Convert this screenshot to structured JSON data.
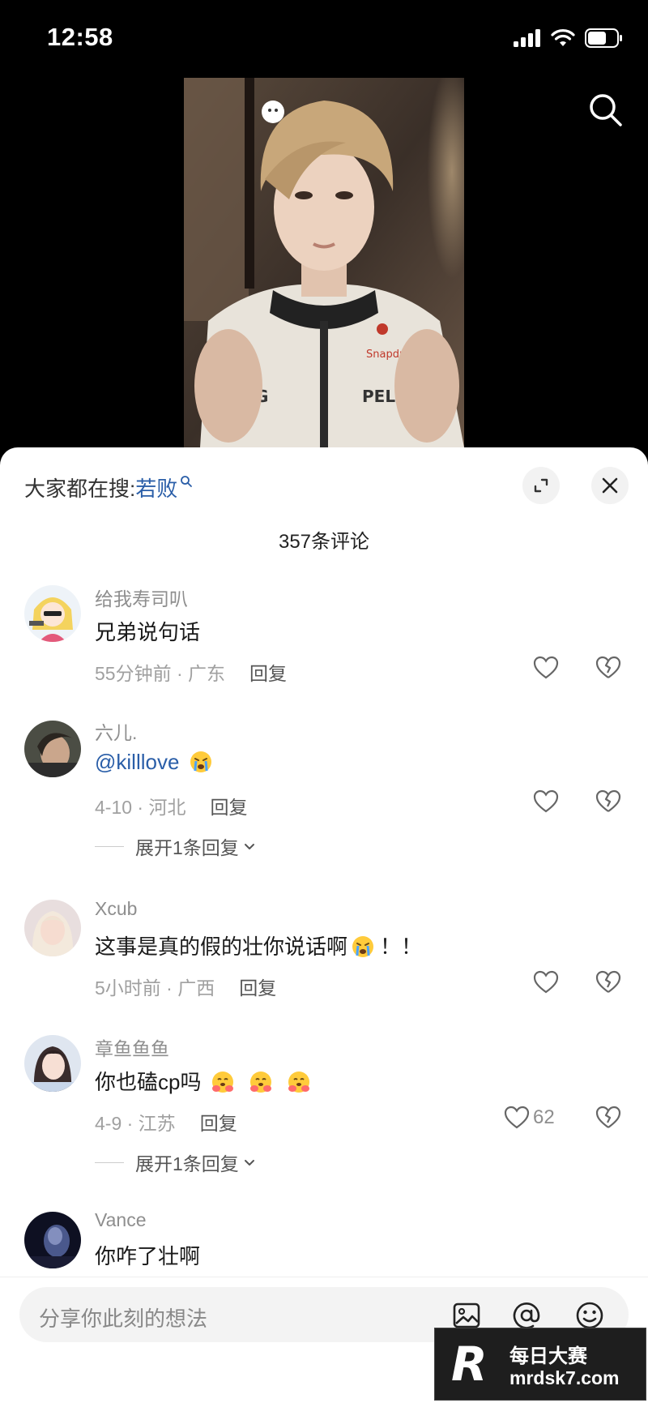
{
  "status": {
    "time": "12:58"
  },
  "sheet": {
    "hot_search_label": "大家都在搜:",
    "hot_search_term": "若败",
    "comment_count": "357条评论"
  },
  "comments": [
    {
      "name": "给我寿司叭",
      "text": "兄弟说句话",
      "meta": "55分钟前 · 广东",
      "reply": "回复"
    },
    {
      "name": "六儿.",
      "text": "@killlove",
      "meta": "4-10 · 河北",
      "reply": "回复",
      "expand": "展开1条回复"
    },
    {
      "name": "Xcub",
      "text": "这事是真的假的壮你说话啊",
      "text_tail": "！！",
      "meta": "5小时前 · 广西",
      "reply": "回复"
    },
    {
      "name": "章鱼鱼鱼",
      "text": "你也磕cp吗",
      "meta": "4-9 · 江苏",
      "reply": "回复",
      "likes": "62",
      "expand": "展开1条回复"
    },
    {
      "name": "Vance",
      "text": "你咋了壮啊"
    }
  ],
  "input": {
    "placeholder": "分享你此刻的想法"
  },
  "watermark": {
    "logo": "R",
    "cn": "每日大赛",
    "url": "mrdsk7.com"
  },
  "icons": [
    "signal-icon",
    "wifi-icon",
    "battery-icon",
    "search-icon",
    "expand-icon",
    "close-icon",
    "heart-icon",
    "broken-heart-icon",
    "chevron-down-icon",
    "image-icon",
    "at-icon",
    "smiley-icon",
    "crying-emoji",
    "hug-emoji"
  ]
}
